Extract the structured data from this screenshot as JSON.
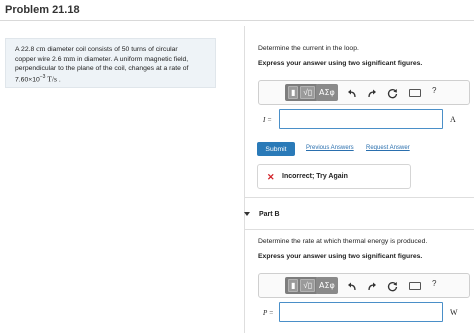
{
  "header": {
    "title": "Problem 21.18"
  },
  "problem": {
    "line1_a": "A 22.8 ",
    "line1_unit": "cm",
    "line1_b": " diameter coil consists of 50 turns of circular",
    "line2_a": "copper wire 2.6 ",
    "line2_unit": "mm",
    "line2_b": " in diameter. A uniform magnetic field,",
    "line3": "perpendicular to the plane of the coil, changes at a rate of",
    "line4_a": "7.60×10",
    "line4_exp": "−3",
    "line4_unit": " T/s",
    "line4_end": " ."
  },
  "part_a": {
    "question": "Determine the current in the loop.",
    "instruction": "Express your answer using two significant figures.",
    "var_label": "I =",
    "unit": "A",
    "submit_label": "Submit",
    "previous_answers": "Previous Answers",
    "request_answer": "Request Answer",
    "feedback": "Incorrect; Try Again"
  },
  "part_b": {
    "label": "Part B",
    "question": "Determine the rate at which thermal energy is produced.",
    "instruction": "Express your answer using two significant figures.",
    "var_label": "P =",
    "unit": "W"
  },
  "toolbar": {
    "template_glyph": "▮",
    "sqrt_glyph": "√▯",
    "greek_label": "ΑΣφ",
    "undo_icon": "undo-arrow-icon",
    "redo_icon": "redo-arrow-icon",
    "reset_icon": "reset-icon",
    "keyboard_icon": "keyboard-icon",
    "help_label": "?"
  },
  "colors": {
    "accent": "#2a7ab8",
    "link": "#2a6fae",
    "error": "#d2232a",
    "input_border": "#4a8fc8",
    "panel_bg": "#eef3f7"
  }
}
